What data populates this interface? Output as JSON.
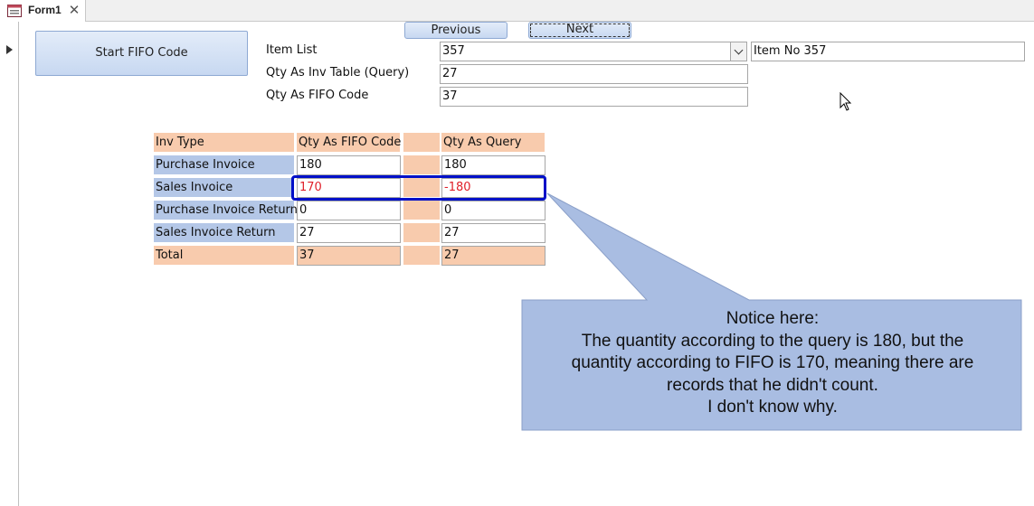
{
  "tab": {
    "title": "Form1",
    "icon": "form-icon",
    "close_icon": "close-icon"
  },
  "buttons": {
    "start": "Start FIFO Code",
    "previous": "Previous",
    "next": "Next"
  },
  "fields": {
    "item_list_label": "Item List",
    "item_list_value": "357",
    "item_name_value": "Item No 357",
    "qty_inv_label": "Qty As Inv Table (Query)",
    "qty_inv_value": "27",
    "qty_fifo_label": "Qty  As FIFO Code",
    "qty_fifo_value": "37"
  },
  "grid": {
    "headers": {
      "type": "Inv Type",
      "fifo": "Qty  As FIFO Code",
      "query": "Qty As Query"
    },
    "rows": [
      {
        "type": "Purchase Invoice",
        "fifo": "180",
        "query": "180"
      },
      {
        "type": "Sales Invoice",
        "fifo": "170",
        "query": "-180"
      },
      {
        "type": "Purchase Invoice Return",
        "fifo": "0",
        "query": "0"
      },
      {
        "type": "Sales Invoice Return",
        "fifo": "27",
        "query": "27"
      }
    ],
    "total": {
      "type": "Total",
      "fifo": "37",
      "query": "27"
    }
  },
  "callout": {
    "text": "Notice here:\nThe quantity according to the query is 180, but the\nquantity according to FIFO is 170, meaning there are\nrecords that he didn't count.\nI don't know why."
  },
  "colors": {
    "header_bg": "#f8cbad",
    "row_label_bg": "#b4c7e7",
    "highlight_border": "#0010c8",
    "callout_bg": "#a9bde2",
    "negative_text": "#e0202a"
  }
}
